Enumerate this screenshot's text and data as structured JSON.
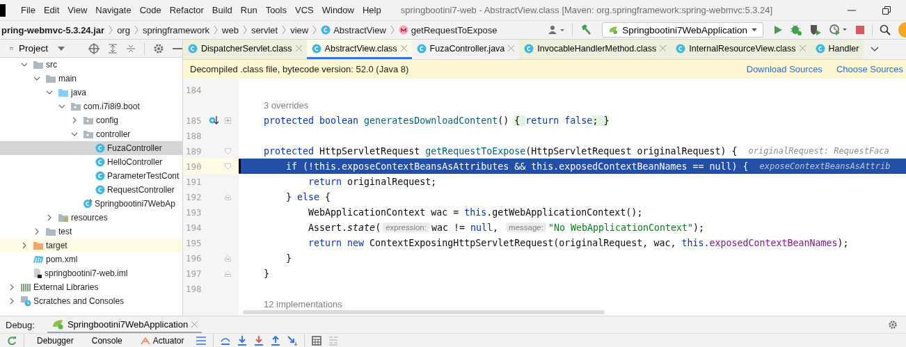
{
  "menu": {
    "items": [
      "File",
      "Edit",
      "View",
      "Navigate",
      "Code",
      "Refactor",
      "Build",
      "Run",
      "Tools",
      "VCS",
      "Window",
      "Help"
    ],
    "title": "springbootini7-web - AbstractView.class [Maven: org.springframework:spring-webmvc:5.3.24]"
  },
  "breadcrumb": [
    {
      "label": "pring-webmvc-5.3.24.jar",
      "kind": "jar"
    },
    {
      "label": "org",
      "kind": "package"
    },
    {
      "label": "springframework",
      "kind": "package"
    },
    {
      "label": "web",
      "kind": "package"
    },
    {
      "label": "servlet",
      "kind": "package"
    },
    {
      "label": "view",
      "kind": "package"
    },
    {
      "label": "AbstractView",
      "kind": "class"
    },
    {
      "label": "getRequestToExpose",
      "kind": "method"
    }
  ],
  "run_config": {
    "label": "Springbootini7WebApplication"
  },
  "project_panel": {
    "title": "Project"
  },
  "tree": {
    "items": [
      {
        "label": "src",
        "kind": "folder",
        "expanded": true,
        "selected": false,
        "highlighted": false,
        "children": [
          {
            "label": "main",
            "kind": "folder",
            "expanded": true,
            "selected": false,
            "highlighted": false,
            "children": [
              {
                "label": "java",
                "kind": "source-folder",
                "expanded": true,
                "selected": false,
                "highlighted": false,
                "children": [
                  {
                    "label": "com.i7i8i9.boot",
                    "kind": "package",
                    "expanded": true,
                    "selected": false,
                    "highlighted": false,
                    "children": [
                      {
                        "label": "config",
                        "kind": "package",
                        "expanded": false,
                        "selected": false,
                        "highlighted": false
                      },
                      {
                        "label": "controller",
                        "kind": "package",
                        "expanded": true,
                        "selected": false,
                        "highlighted": false,
                        "children": [
                          {
                            "label": "FuzaController",
                            "kind": "class",
                            "selected": true,
                            "highlighted": false
                          },
                          {
                            "label": "HelloController",
                            "kind": "class",
                            "selected": false,
                            "highlighted": false
                          },
                          {
                            "label": "ParameterTestCont",
                            "kind": "class",
                            "selected": false,
                            "highlighted": false
                          },
                          {
                            "label": "RequestController",
                            "kind": "class",
                            "selected": false,
                            "highlighted": false
                          }
                        ]
                      },
                      {
                        "label": "Springbootini7WebAp",
                        "kind": "app-class",
                        "selected": false,
                        "highlighted": false
                      }
                    ]
                  }
                ]
              },
              {
                "label": "resources",
                "kind": "resources-folder",
                "expanded": false,
                "selected": false,
                "highlighted": false
              }
            ]
          },
          {
            "label": "test",
            "kind": "folder",
            "expanded": false,
            "selected": false,
            "highlighted": false
          }
        ]
      },
      {
        "label": "target",
        "kind": "excluded-folder",
        "expanded": false,
        "selected": false,
        "highlighted": true
      },
      {
        "label": "pom.xml",
        "kind": "maven",
        "selected": false,
        "highlighted": false
      },
      {
        "label": "springbootini7-web.iml",
        "kind": "module-file",
        "selected": false,
        "highlighted": false
      }
    ],
    "roots": [
      {
        "label": "External Libraries",
        "kind": "libraries",
        "expanded": false,
        "selected": false,
        "highlighted": false
      },
      {
        "label": "Scratches and Consoles",
        "kind": "scratches",
        "expanded": false,
        "selected": false,
        "highlighted": false
      }
    ]
  },
  "tabs": [
    {
      "label": "DispatcherServlet.class",
      "library": true,
      "selected": false
    },
    {
      "label": "AbstractView.class",
      "library": true,
      "selected": true
    },
    {
      "label": "FuzaController.java",
      "library": false,
      "selected": false
    },
    {
      "label": "InvocableHandlerMethod.class",
      "library": true,
      "selected": false
    },
    {
      "label": "InternalResourceView.class",
      "library": true,
      "selected": false
    },
    {
      "label": "Handler",
      "library": true,
      "selected": false
    }
  ],
  "notice": {
    "text": "Decompiled .class file, bytecode version: 52.0 (Java 8)",
    "links": [
      "Download Sources",
      "Choose Sources"
    ]
  },
  "editor": {
    "lines": [
      {
        "kind": "code",
        "number": "184",
        "current": false
      },
      {
        "kind": "hint",
        "text": "3 overrides"
      },
      {
        "kind": "code",
        "number": "185",
        "current": false,
        "markers": [
          {
            "kind": "overridden"
          },
          {
            "kind": "fold-collapsed"
          }
        ],
        "segments": [
          {
            "kind": "code",
            "tokens": [
              {
                "kind": "keyword",
                "text": "protected boolean "
              },
              {
                "kind": "method",
                "text": "generatesDownloadContent"
              },
              {
                "kind": "plain",
                "text": "() "
              },
              {
                "kind": "folded",
                "text": "{ "
              },
              {
                "kind": "keyword",
                "text": "return false"
              },
              {
                "kind": "folded",
                "text": "; }"
              }
            ]
          }
        ]
      },
      {
        "kind": "code",
        "number": "188",
        "current": false
      },
      {
        "kind": "code",
        "number": "189",
        "current": false,
        "markers": [
          {
            "kind": "fold-start"
          }
        ],
        "segments": [
          {
            "kind": "code",
            "tokens": [
              {
                "kind": "keyword",
                "text": "protected "
              },
              {
                "kind": "plain",
                "text": "HttpServletRequest "
              },
              {
                "kind": "method",
                "text": "getRequestToExpose"
              },
              {
                "kind": "plain",
                "text": "(HttpServletRequest originalRequest) {"
              }
            ]
          },
          {
            "kind": "value",
            "text": "originalRequest: RequestFaca"
          }
        ]
      },
      {
        "kind": "code",
        "number": "190",
        "current": true,
        "markers": [
          {
            "kind": "fold-start"
          }
        ],
        "segments": [
          {
            "kind": "code",
            "tokens": [
              {
                "kind": "keyword",
                "text": "    if "
              },
              {
                "kind": "plain",
                "text": "(!"
              },
              {
                "kind": "keyword",
                "text": "this."
              },
              {
                "kind": "field",
                "text": "exposeContextBeansAsAttributes"
              },
              {
                "kind": "plain",
                "text": " && "
              },
              {
                "kind": "keyword",
                "text": "this."
              },
              {
                "kind": "field",
                "text": "exposedContextBeanNames"
              },
              {
                "kind": "plain",
                "text": " == "
              },
              {
                "kind": "keyword",
                "text": "null"
              },
              {
                "kind": "plain",
                "text": ") {"
              }
            ]
          },
          {
            "kind": "value",
            "text": "exposeContextBeansAsAttrib"
          }
        ]
      },
      {
        "kind": "code",
        "number": "191",
        "current": false,
        "segments": [
          {
            "kind": "code",
            "tokens": [
              {
                "kind": "keyword",
                "text": "        return "
              },
              {
                "kind": "plain",
                "text": "originalRequest;"
              }
            ]
          }
        ]
      },
      {
        "kind": "code",
        "number": "192",
        "current": false,
        "markers": [
          {
            "kind": "fold-end"
          }
        ],
        "segments": [
          {
            "kind": "code",
            "tokens": [
              {
                "kind": "plain",
                "text": "    } "
              },
              {
                "kind": "keyword",
                "text": "else"
              },
              {
                "kind": "plain",
                "text": " {"
              }
            ]
          }
        ]
      },
      {
        "kind": "code",
        "number": "193",
        "current": false,
        "segments": [
          {
            "kind": "code",
            "tokens": [
              {
                "kind": "plain",
                "text": "        WebApplicationContext wac = "
              },
              {
                "kind": "keyword",
                "text": "this"
              },
              {
                "kind": "plain",
                "text": ".getWebApplicationContext();"
              }
            ]
          }
        ]
      },
      {
        "kind": "code",
        "number": "194",
        "current": false,
        "segments": [
          {
            "kind": "code",
            "tokens": [
              {
                "kind": "plain",
                "text": "        Assert."
              },
              {
                "kind": "italic",
                "text": "state"
              },
              {
                "kind": "plain",
                "text": "("
              }
            ]
          },
          {
            "kind": "inlay",
            "text": "expression:"
          },
          {
            "kind": "code",
            "tokens": [
              {
                "kind": "plain",
                "text": "wac != "
              },
              {
                "kind": "keyword",
                "text": "null"
              },
              {
                "kind": "plain",
                "text": ", "
              }
            ]
          },
          {
            "kind": "inlay",
            "text": "message:"
          },
          {
            "kind": "code",
            "tokens": [
              {
                "kind": "string",
                "text": "\"No WebApplicationContext\""
              },
              {
                "kind": "plain",
                "text": ");"
              }
            ]
          }
        ]
      },
      {
        "kind": "code",
        "number": "195",
        "current": false,
        "segments": [
          {
            "kind": "code",
            "tokens": [
              {
                "kind": "keyword",
                "text": "        return new "
              },
              {
                "kind": "plain",
                "text": "ContextExposingHttpServletRequest(originalRequest, wac, "
              },
              {
                "kind": "keyword",
                "text": "this."
              },
              {
                "kind": "field",
                "text": "exposedContextBeanNames"
              },
              {
                "kind": "plain",
                "text": ");"
              }
            ]
          }
        ]
      },
      {
        "kind": "code",
        "number": "196",
        "current": false,
        "markers": [
          {
            "kind": "fold-end"
          }
        ],
        "segments": [
          {
            "kind": "code",
            "tokens": [
              {
                "kind": "plain",
                "text": "    }"
              }
            ]
          }
        ]
      },
      {
        "kind": "code",
        "number": "197",
        "current": false,
        "markers": [
          {
            "kind": "fold-end"
          }
        ],
        "segments": [
          {
            "kind": "code",
            "tokens": [
              {
                "kind": "plain",
                "text": "}"
              }
            ]
          }
        ]
      },
      {
        "kind": "code",
        "number": "198",
        "current": false
      },
      {
        "kind": "hint",
        "text": "12 implementations"
      }
    ]
  },
  "debug": {
    "label": "Debug:",
    "session": "Springbootini7WebApplication",
    "tabs": [
      {
        "label": "Debugger",
        "kind": "plain"
      },
      {
        "label": "Console",
        "kind": "plain"
      },
      {
        "label": "Actuator",
        "kind": "actuator"
      }
    ]
  }
}
